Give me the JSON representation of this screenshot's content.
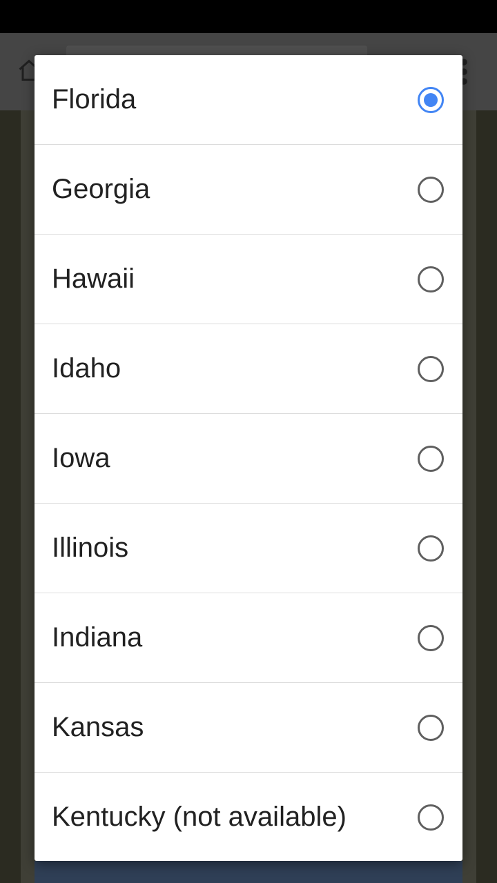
{
  "dialog": {
    "options": [
      {
        "label": "Florida",
        "selected": true
      },
      {
        "label": "Georgia",
        "selected": false
      },
      {
        "label": "Hawaii",
        "selected": false
      },
      {
        "label": "Idaho",
        "selected": false
      },
      {
        "label": "Iowa",
        "selected": false
      },
      {
        "label": "Illinois",
        "selected": false
      },
      {
        "label": "Indiana",
        "selected": false
      },
      {
        "label": "Kansas",
        "selected": false
      },
      {
        "label": "Kentucky (not available)",
        "selected": false
      }
    ]
  },
  "colors": {
    "radio_selected": "#4285f4",
    "radio_unselected": "#5f5f5f",
    "text": "#212121",
    "divider": "#dcdcdc"
  },
  "icons": {
    "home": "home-icon",
    "menu": "more-vert-icon",
    "radio_on": "radio-selected-icon",
    "radio_off": "radio-unselected-icon"
  }
}
